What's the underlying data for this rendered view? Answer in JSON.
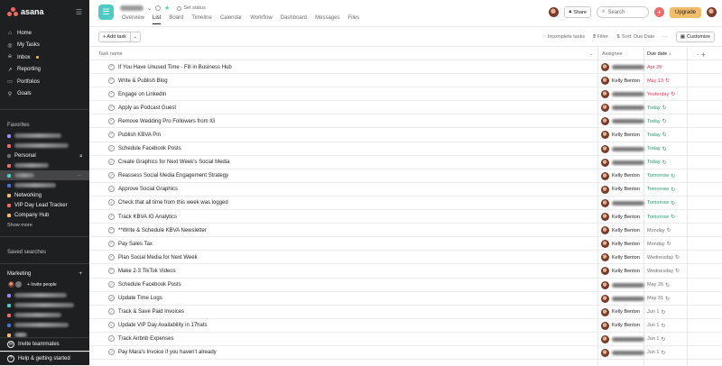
{
  "sidebar": {
    "logo": "asana",
    "nav": [
      {
        "label": "Home",
        "icon": "home-icon"
      },
      {
        "label": "My Tasks",
        "icon": "check-circle-icon"
      },
      {
        "label": "Inbox",
        "icon": "bell-icon"
      },
      {
        "label": "Reporting",
        "icon": "chart-icon"
      },
      {
        "label": "Portfolios",
        "icon": "portfolio-icon"
      },
      {
        "label": "Goals",
        "icon": "person-icon"
      }
    ],
    "favorites_heading": "Favorites",
    "favorites": [
      {
        "label": "",
        "color": "#9b87f5"
      },
      {
        "label": "",
        "color": "#f06a6a"
      },
      {
        "label": "Personal",
        "color": "#6d6e6f"
      },
      {
        "label": "",
        "color": "#f06a6a"
      },
      {
        "label": "",
        "color": "#4ecbc4"
      },
      {
        "label": "",
        "color": "#4573d2"
      },
      {
        "label": "Networking",
        "color": "#f1bd6c"
      },
      {
        "label": "VIP Day Lead Tracker",
        "color": "#f06a6a"
      },
      {
        "label": "Company Hub",
        "color": "#f1bd6c"
      }
    ],
    "show_more": "Show more",
    "saved_searches": "Saved searches",
    "team_name": "Marketing",
    "invite_people": "+ Invite people",
    "team_projects": [
      {
        "color": "#9b87f5"
      },
      {
        "color": "#4ecbc4"
      },
      {
        "color": "#f06a6a"
      },
      {
        "color": "#4573d2"
      },
      {
        "color": "#f1bd6c"
      }
    ],
    "invite_teammates": "Invite teammates",
    "help": "Help & getting started"
  },
  "header": {
    "set_status": "Set status",
    "tabs": [
      "Overview",
      "List",
      "Board",
      "Timeline",
      "Calendar",
      "Workflow",
      "Dashboard",
      "Messages",
      "Files"
    ],
    "active_tab": "List",
    "share": "Share",
    "search_placeholder": "Search",
    "upgrade": "Upgrade"
  },
  "toolbar": {
    "add_task": "+ Add task",
    "incomplete": "Incomplete tasks",
    "filter": "Filter",
    "sort": "Sort: Due Date",
    "more": "···",
    "customize": "Customize"
  },
  "columns": {
    "task_name": "Task name",
    "assignee": "Assignee",
    "due_date": "Due date ↓",
    "add": "+"
  },
  "colors": {
    "red": "#e8384f",
    "green": "#2a9d6b",
    "gray": "#6d6e6f"
  },
  "tasks": [
    {
      "name": "If You Have Unused Time - Fill in Business Hub",
      "assignee": "",
      "due": "Apr 29",
      "due_color": "#e8384f",
      "repeat": false
    },
    {
      "name": "Write & Publish Blog",
      "assignee": "Kelly Benton",
      "due": "May 13",
      "due_color": "#e8384f",
      "repeat": true
    },
    {
      "name": "Engage on LinkedIn",
      "assignee": "",
      "due": "Yesterday",
      "due_color": "#e8384f",
      "repeat": true
    },
    {
      "name": "Apply as Podcast Guest",
      "assignee": "",
      "due": "Today",
      "due_color": "#2a9d6b",
      "repeat": true
    },
    {
      "name": "Remove Wedding Pro Followers from IG",
      "assignee": "",
      "due": "Today",
      "due_color": "#2a9d6b",
      "repeat": true
    },
    {
      "name": "Publish KBVA Pin",
      "assignee": "Kelly Benton",
      "due": "Today",
      "due_color": "#2a9d6b",
      "repeat": true
    },
    {
      "name": "Schedule Facebook Posts",
      "assignee": "",
      "due": "Today",
      "due_color": "#2a9d6b",
      "repeat": true
    },
    {
      "name": "Create Graphics for Next Week's Social Media",
      "assignee": "",
      "due": "Today",
      "due_color": "#2a9d6b",
      "repeat": true
    },
    {
      "name": "Reassess Social Media Engagement Strategy",
      "assignee": "Kelly Benton",
      "due": "Tomorrow",
      "due_color": "#2a9d6b",
      "repeat": true
    },
    {
      "name": "Approve Social Graphics",
      "assignee": "Kelly Benton",
      "due": "Tomorrow",
      "due_color": "#2a9d6b",
      "repeat": true
    },
    {
      "name": "Check that all time from this week was logged",
      "assignee": "",
      "due": "Tomorrow",
      "due_color": "#2a9d6b",
      "repeat": true
    },
    {
      "name": "Track KBVA IG Analytics",
      "assignee": "Kelly Benton",
      "due": "Tomorrow",
      "due_color": "#2a9d6b",
      "repeat": true
    },
    {
      "name": "**Write & Schedule KBVA Newsletter",
      "assignee": "Kelly Benton",
      "due": "Monday",
      "due_color": "#6d6e6f",
      "repeat": true
    },
    {
      "name": "Pay Sales Tax",
      "assignee": "Kelly Benton",
      "due": "Monday",
      "due_color": "#6d6e6f",
      "repeat": true
    },
    {
      "name": "Plan Social Media for Next Week",
      "assignee": "Kelly Benton",
      "due": "Wednesday",
      "due_color": "#6d6e6f",
      "repeat": true
    },
    {
      "name": "Make 2-3 TikTok Videos",
      "assignee": "Kelly Benton",
      "due": "Wednesday",
      "due_color": "#6d6e6f",
      "repeat": true
    },
    {
      "name": "Schedule Facebook Posts",
      "assignee": "",
      "due": "May 26",
      "due_color": "#6d6e6f",
      "repeat": true
    },
    {
      "name": "Update Time Logs",
      "assignee": "",
      "due": "May 31",
      "due_color": "#6d6e6f",
      "repeat": true
    },
    {
      "name": "Track & Save Paid Invoices",
      "assignee": "Kelly Benton",
      "due": "Jun 1",
      "due_color": "#6d6e6f",
      "repeat": true
    },
    {
      "name": "Update VIP Day Availability in 17hats",
      "assignee": "Kelly Benton",
      "due": "Jun 1",
      "due_color": "#6d6e6f",
      "repeat": true
    },
    {
      "name": "Track Airbnb Expenses",
      "assignee": "",
      "due": "Jun 1",
      "due_color": "#6d6e6f",
      "repeat": true
    },
    {
      "name": "Pay Mara's Invoice if you haven't already",
      "assignee": "",
      "due": "Jun 1",
      "due_color": "#6d6e6f",
      "repeat": true
    }
  ]
}
